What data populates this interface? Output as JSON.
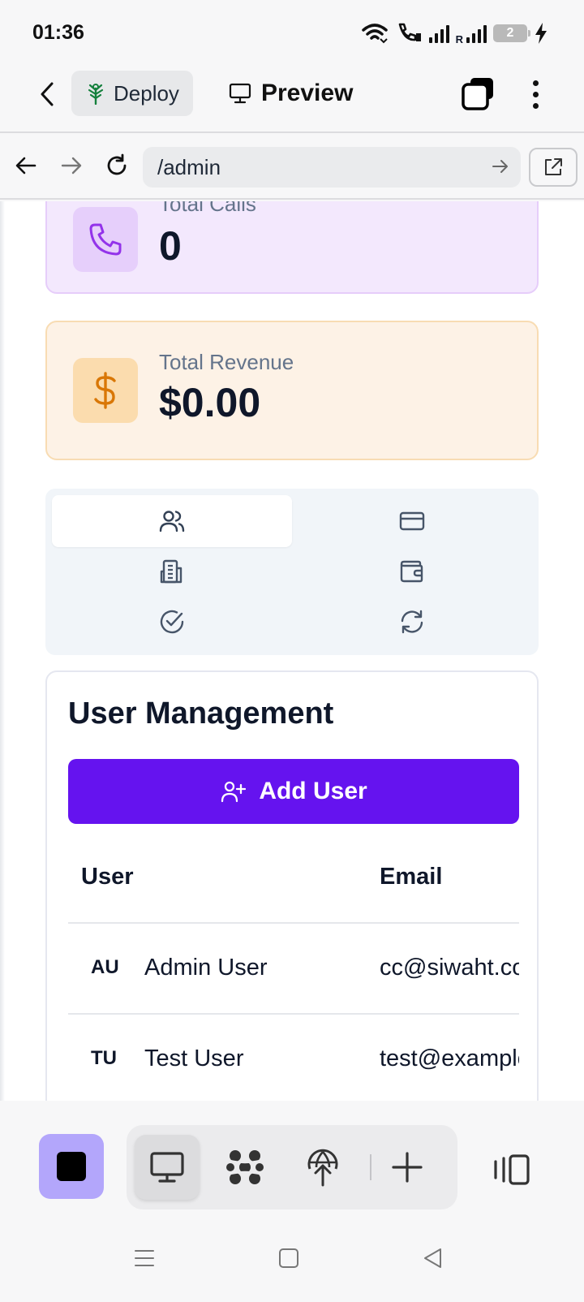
{
  "status_bar": {
    "time": "01:36",
    "battery_level": "2",
    "icons": [
      "wifi-icon",
      "wifi-calling-icon",
      "signal-icon",
      "roaming-signal-icon",
      "battery-icon",
      "charging-icon"
    ],
    "roaming_label": "R"
  },
  "app_toolbar": {
    "deploy_label": "Deploy",
    "preview_label": "Preview"
  },
  "url_bar": {
    "url": "/admin"
  },
  "stats": {
    "calls": {
      "label": "Total Calls",
      "value": "0"
    },
    "revenue": {
      "label": "Total Revenue",
      "value": "$0.00"
    }
  },
  "admin_tabs": [
    {
      "icon": "users-icon",
      "active": true
    },
    {
      "icon": "credit-card-icon",
      "active": false
    },
    {
      "icon": "building-icon",
      "active": false
    },
    {
      "icon": "wallet-icon",
      "active": false
    },
    {
      "icon": "check-circle-icon",
      "active": false
    },
    {
      "icon": "refresh-icon",
      "active": false
    }
  ],
  "user_management": {
    "title": "User Management",
    "add_button": "Add User",
    "columns": [
      "User",
      "Email"
    ],
    "rows": [
      {
        "initials": "AU",
        "name": "Admin User",
        "email": "cc@siwaht.com"
      },
      {
        "initials": "TU",
        "name": "Test User",
        "email": "test@example.com"
      }
    ]
  },
  "colors": {
    "accent": "#6513ef",
    "calls_bg": "#f3e8fd",
    "calls_icon": "#9333ea",
    "revenue_bg": "#fdf2e6",
    "revenue_icon": "#d97706"
  }
}
